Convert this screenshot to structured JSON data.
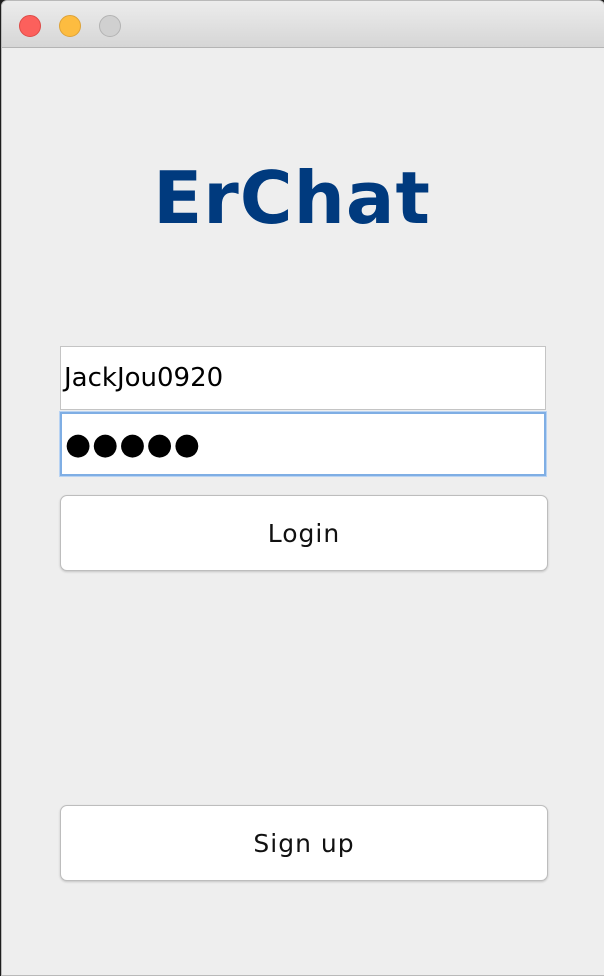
{
  "app": {
    "title": "ErChat"
  },
  "form": {
    "username_value": "JackJou0920",
    "password_mask": "●●●●●"
  },
  "buttons": {
    "login_label": "Login",
    "signup_label": "Sign up"
  },
  "colors": {
    "title": "#003a7e",
    "window_bg": "#eeeeee",
    "focus_ring": "#7faee4",
    "close": "#fc605c",
    "minimize": "#fdbc40",
    "zoom_inactive": "#d0d0d0"
  }
}
